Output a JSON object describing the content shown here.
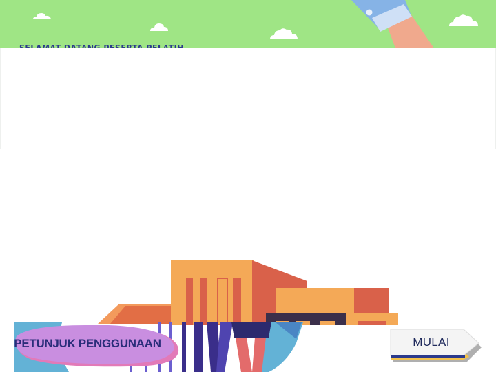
{
  "header": {
    "welcome_text": "SELAMAT DATANG PESERTA PELATIHAN",
    "background_color": "#9fe585"
  },
  "buttons": {
    "guide_label": "PETUNJUK PENGGUNAAN",
    "guide_color": "#c98ee0",
    "start_label": "MULAI",
    "start_color": "#f4f4f4",
    "start_accent": "#f2c14a"
  },
  "illustration": {
    "icons": [
      "cloud-icon",
      "hand-sleeve-icon",
      "building-illustration",
      "people-illustration"
    ]
  }
}
